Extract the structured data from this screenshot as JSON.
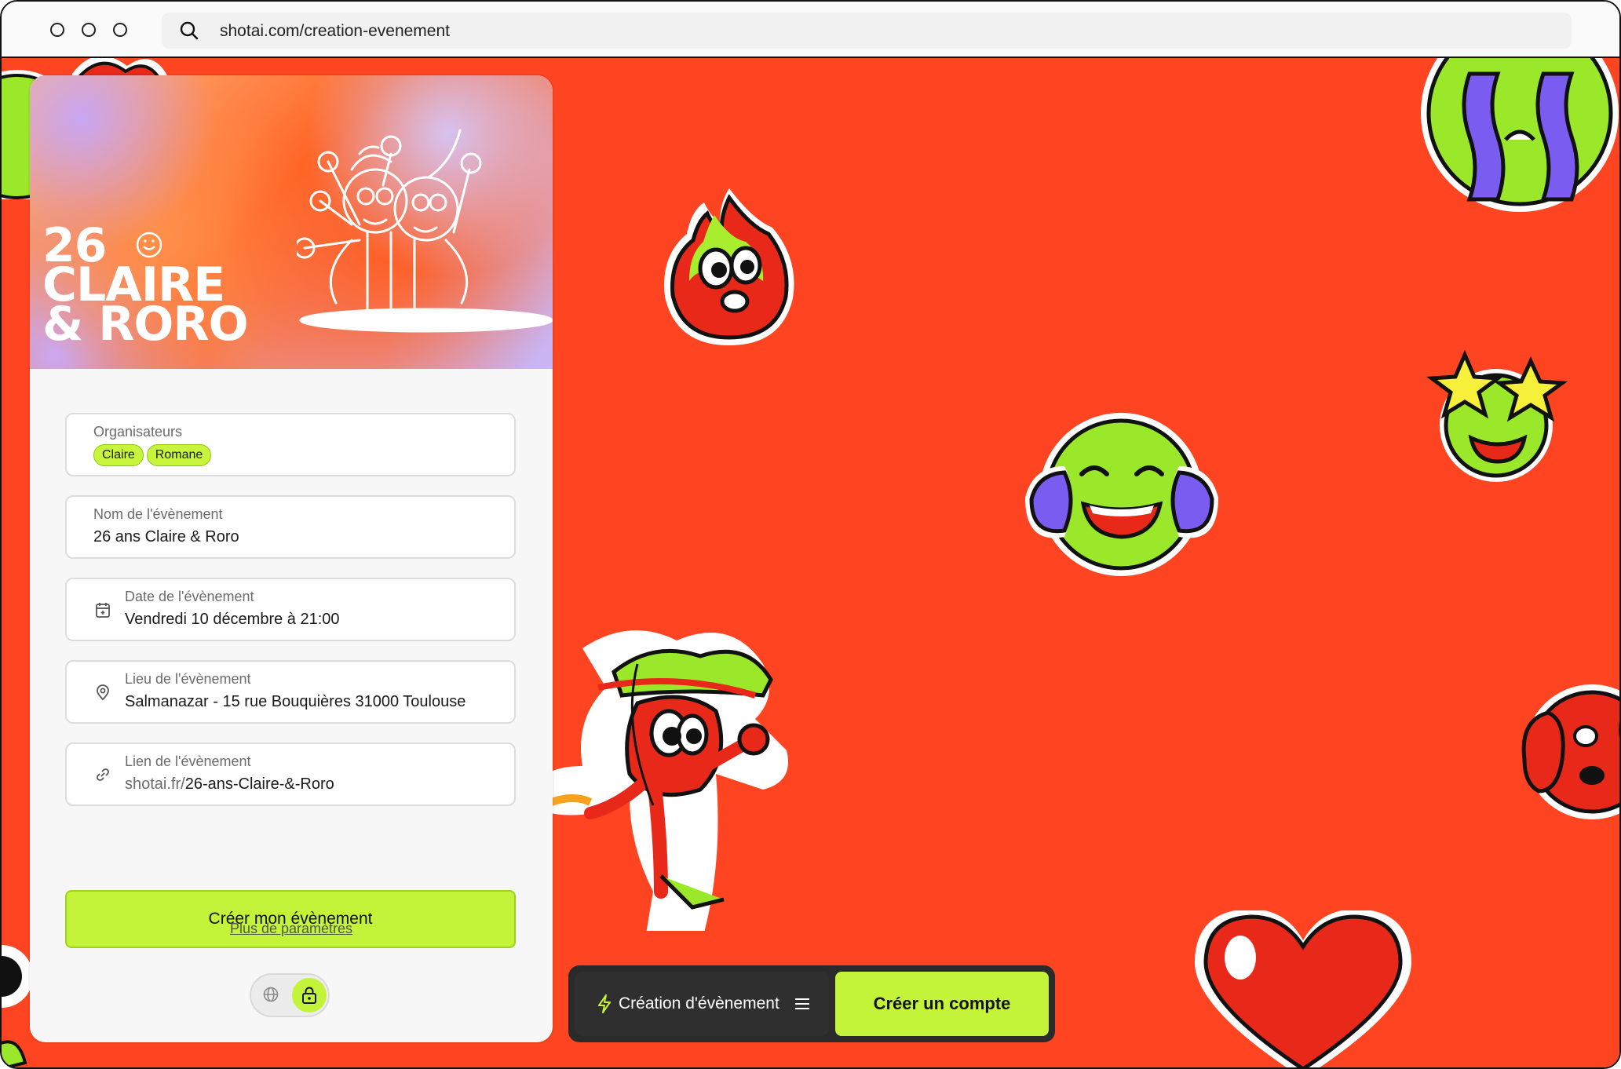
{
  "browser": {
    "url": "shotai.com/creation-evenement",
    "icons": [
      "window-dot-icon",
      "search-icon"
    ]
  },
  "hero": {
    "line1": "26",
    "line2": "CLAIRE",
    "line3": "& RORO"
  },
  "form": {
    "organizers": {
      "label": "Organisateurs",
      "chips": [
        "Claire",
        "Romane"
      ]
    },
    "event_name": {
      "label": "Nom de l'évènement",
      "value": "26 ans Claire & Roro"
    },
    "event_date": {
      "label": "Date de l'évènement",
      "value": "Vendredi 10 décembre à 21:00",
      "icon": "calendar-icon"
    },
    "event_place": {
      "label": "Lieu de l'évènement",
      "value": "Salmanazar - 15 rue Bouquières 31000 Toulouse",
      "icon": "map-pin-icon"
    },
    "event_link": {
      "label": "Lien de l'évènement",
      "prefix": "shotai.fr/",
      "slug": "26-ans-Claire-&-Roro",
      "icon": "link-icon"
    },
    "submit_label": "Créer mon évènement",
    "more_settings": "Plus de paramètres",
    "visibility_toggle": {
      "options": [
        "globe-icon",
        "lock-icon"
      ],
      "selected": "lock-icon"
    }
  },
  "bottom_bar": {
    "menu_label": "Création d'évènement",
    "menu_icons": [
      "bolt-icon",
      "hamburger-icon"
    ],
    "signup_label": "Créer un compte"
  },
  "colors": {
    "background": "#fe4420",
    "accent_lime": "#c4f43a",
    "dark_bar": "#2a2a2a"
  }
}
